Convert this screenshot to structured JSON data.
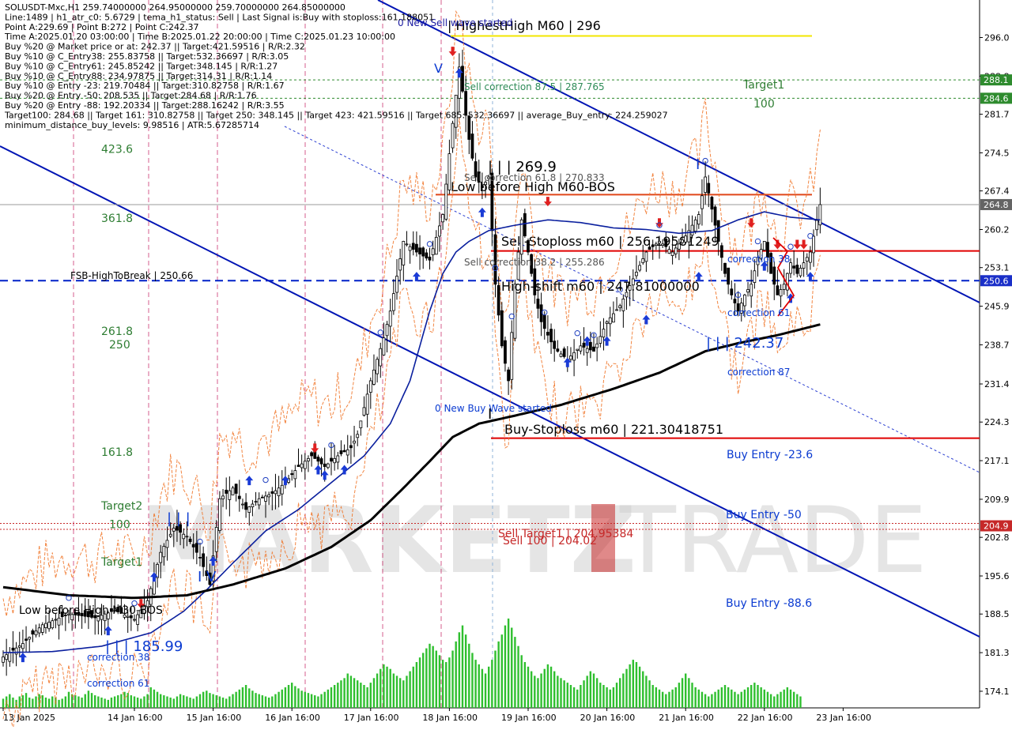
{
  "header": {
    "lines": [
      "SOLUSDT-Mxc,H1  259.74000000 264.95000000 259.70000000 264.85000000",
      "Line:1489 | h1_atr_c0: 5.6729 | tema_h1_status: Sell | Last Signal is:Buy with stoploss:161.188051",
      "Point A:229.69 | Point B:272 | Point C:242.37",
      "Time A:2025.01.20 03:00:00 | Time B:2025.01.22 20:00:00 | Time C:2025.01.23 10:00:00",
      "Buy %20 @ Market price or at: 242.37 || Target:421.59516 | R/R:2.32",
      "Buy %10 @ C_Entry38: 255.83758 || Target:532.36697 | R/R:3.05",
      "Buy %10 @ C_Entry61: 245.85242 || Target:348.145 | R/R:1.27",
      "Buy %10 @ C_Entry88: 234.97875 || Target:314.31 | R/R:1.14",
      "Buy %10 @ Entry -23: 219.70484 || Target:310.82758 | R/R:1.67",
      "Buy %20 @ Entry -50: 208.535 || Target:284.68 | R/R:1.76",
      "Buy %20 @ Entry -88: 192.20334 || Target:288.16242 | R/R:3.55",
      "Target100: 284.68 || Target 161: 310.82758 || Target 250: 348.145 || Target 423: 421.59516 || Target 685: 532.36697 || average_Buy_entry: 224.259027",
      "minimum_distance_buy_levels: 9.98516 | ATR:5.67285714"
    ]
  },
  "watermark": {
    "left": "MARKETZ",
    "right": "TRADE"
  },
  "chart_data": {
    "type": "line",
    "title": "SOLUSDT-Mxc,H1",
    "ylim": [
      171.0,
      303.0
    ],
    "y_ticks": [
      {
        "label": "296.0",
        "value": 296.0
      },
      {
        "label": "288.8",
        "value": 288.8
      },
      {
        "label": "281.7",
        "value": 281.7
      },
      {
        "label": "274.5",
        "value": 274.5
      },
      {
        "label": "267.4",
        "value": 267.4
      },
      {
        "label": "260.2",
        "value": 260.2
      },
      {
        "label": "253.1",
        "value": 253.1
      },
      {
        "label": "245.9",
        "value": 245.9
      },
      {
        "label": "238.7",
        "value": 238.7
      },
      {
        "label": "231.4",
        "value": 231.4
      },
      {
        "label": "224.3",
        "value": 224.3
      },
      {
        "label": "217.1",
        "value": 217.1
      },
      {
        "label": "209.9",
        "value": 209.9
      },
      {
        "label": "202.8",
        "value": 202.8
      },
      {
        "label": "195.6",
        "value": 195.6
      },
      {
        "label": "188.5",
        "value": 188.5
      },
      {
        "label": "181.3",
        "value": 181.3
      },
      {
        "label": "174.1",
        "value": 174.1
      }
    ],
    "x_ticks": [
      {
        "label": "13 Jan 2025",
        "idx": 0
      },
      {
        "label": "14 Jan 16:00",
        "idx": 40
      },
      {
        "label": "15 Jan 16:00",
        "idx": 64
      },
      {
        "label": "16 Jan 16:00",
        "idx": 88
      },
      {
        "label": "17 Jan 16:00",
        "idx": 112
      },
      {
        "label": "18 Jan 16:00",
        "idx": 136
      },
      {
        "label": "19 Jan 16:00",
        "idx": 160
      },
      {
        "label": "20 Jan 16:00",
        "idx": 184
      },
      {
        "label": "21 Jan 16:00",
        "idx": 208
      },
      {
        "label": "22 Jan 16:00",
        "idx": 232
      },
      {
        "label": "23 Jan 16:00",
        "idx": 256
      }
    ],
    "price_anchors": [
      [
        0,
        180.5
      ],
      [
        6,
        183
      ],
      [
        12,
        186.5
      ],
      [
        20,
        188.5
      ],
      [
        28,
        187.8
      ],
      [
        34,
        189.2
      ],
      [
        40,
        187.5
      ],
      [
        44,
        191
      ],
      [
        48,
        200
      ],
      [
        52,
        204.5
      ],
      [
        56,
        203
      ],
      [
        60,
        199
      ],
      [
        63,
        194
      ],
      [
        66,
        210
      ],
      [
        70,
        212
      ],
      [
        74,
        208
      ],
      [
        78,
        210
      ],
      [
        82,
        211
      ],
      [
        86,
        213
      ],
      [
        90,
        216
      ],
      [
        94,
        218
      ],
      [
        98,
        216
      ],
      [
        102,
        218
      ],
      [
        106,
        219.5
      ],
      [
        108,
        222
      ],
      [
        112,
        232
      ],
      [
        116,
        240
      ],
      [
        118,
        245
      ],
      [
        122,
        258
      ],
      [
        126,
        256
      ],
      [
        130,
        254.5
      ],
      [
        134,
        263
      ],
      [
        137,
        280
      ],
      [
        139,
        290.5
      ],
      [
        142,
        277
      ],
      [
        144,
        270
      ],
      [
        146,
        268
      ],
      [
        148,
        270
      ],
      [
        150,
        250
      ],
      [
        152,
        238.5
      ],
      [
        154,
        232
      ],
      [
        156,
        250
      ],
      [
        158,
        262
      ],
      [
        160,
        256
      ],
      [
        162,
        248
      ],
      [
        164,
        243
      ],
      [
        168,
        238
      ],
      [
        172,
        236
      ],
      [
        176,
        238.5
      ],
      [
        180,
        237.5
      ],
      [
        184,
        243
      ],
      [
        188,
        246
      ],
      [
        192,
        251
      ],
      [
        196,
        256
      ],
      [
        200,
        258
      ],
      [
        204,
        256
      ],
      [
        208,
        259
      ],
      [
        212,
        263
      ],
      [
        214,
        270
      ],
      [
        216,
        264
      ],
      [
        218,
        258
      ],
      [
        220,
        252
      ],
      [
        222,
        248
      ],
      [
        224,
        245
      ],
      [
        226,
        248
      ],
      [
        228,
        250
      ],
      [
        230,
        255
      ],
      [
        232,
        258
      ],
      [
        234,
        252
      ],
      [
        236,
        248
      ],
      [
        238,
        250
      ],
      [
        240,
        254
      ],
      [
        242,
        252
      ],
      [
        246,
        256
      ],
      [
        249,
        264.85
      ]
    ],
    "sma_blue": [
      [
        0,
        181.3
      ],
      [
        15,
        181.5
      ],
      [
        30,
        182.5
      ],
      [
        45,
        185
      ],
      [
        55,
        189
      ],
      [
        62,
        193
      ],
      [
        70,
        198
      ],
      [
        80,
        204
      ],
      [
        90,
        208
      ],
      [
        100,
        213
      ],
      [
        110,
        218
      ],
      [
        118,
        224
      ],
      [
        124,
        232
      ],
      [
        130,
        245
      ],
      [
        134,
        252
      ],
      [
        138,
        256
      ],
      [
        142,
        258
      ],
      [
        148,
        260
      ],
      [
        156,
        261
      ],
      [
        166,
        262
      ],
      [
        176,
        261.5
      ],
      [
        186,
        260.5
      ],
      [
        196,
        260.2
      ],
      [
        206,
        259.5
      ],
      [
        216,
        260
      ],
      [
        224,
        262
      ],
      [
        232,
        263.5
      ],
      [
        240,
        262.5
      ],
      [
        249,
        262
      ]
    ],
    "sma_black": [
      [
        0,
        193.5
      ],
      [
        20,
        192
      ],
      [
        40,
        191.5
      ],
      [
        56,
        192
      ],
      [
        70,
        194
      ],
      [
        86,
        197
      ],
      [
        100,
        201
      ],
      [
        112,
        206
      ],
      [
        122,
        212
      ],
      [
        130,
        217
      ],
      [
        137,
        221.5
      ],
      [
        145,
        224
      ],
      [
        156,
        225.5
      ],
      [
        170,
        227.5
      ],
      [
        186,
        230.5
      ],
      [
        200,
        233.5
      ],
      [
        214,
        237.5
      ],
      [
        224,
        239
      ],
      [
        236,
        240.5
      ],
      [
        249,
        242.5
      ]
    ],
    "volume": [
      8,
      10,
      12,
      9,
      7,
      10,
      11,
      13,
      9,
      8,
      10,
      12,
      11,
      9,
      8,
      10,
      9,
      7,
      8,
      10,
      14,
      12,
      11,
      10,
      9,
      12,
      15,
      13,
      11,
      10,
      9,
      8,
      7,
      9,
      10,
      11,
      12,
      14,
      13,
      11,
      10,
      9,
      8,
      10,
      12,
      18,
      16,
      14,
      12,
      11,
      10,
      9,
      8,
      10,
      12,
      11,
      10,
      9,
      8,
      10,
      12,
      14,
      15,
      13,
      12,
      11,
      10,
      9,
      8,
      10,
      12,
      14,
      16,
      18,
      20,
      17,
      15,
      13,
      12,
      11,
      10,
      9,
      10,
      12,
      14,
      16,
      18,
      20,
      22,
      19,
      17,
      15,
      14,
      13,
      12,
      11,
      10,
      12,
      14,
      16,
      18,
      20,
      22,
      24,
      26,
      30,
      28,
      26,
      24,
      22,
      20,
      18,
      22,
      26,
      30,
      34,
      38,
      36,
      34,
      30,
      28,
      26,
      24,
      28,
      32,
      36,
      40,
      44,
      48,
      52,
      56,
      54,
      50,
      46,
      42,
      40,
      44,
      50,
      58,
      66,
      72,
      64,
      56,
      48,
      42,
      38,
      34,
      30,
      36,
      42,
      50,
      58,
      64,
      72,
      78,
      70,
      62,
      54,
      46,
      40,
      36,
      32,
      28,
      26,
      30,
      34,
      38,
      36,
      32,
      28,
      26,
      24,
      22,
      20,
      18,
      16,
      20,
      24,
      28,
      32,
      30,
      26,
      22,
      20,
      18,
      16,
      18,
      22,
      26,
      30,
      34,
      38,
      42,
      40,
      36,
      32,
      28,
      24,
      20,
      18,
      16,
      14,
      12,
      14,
      16,
      18,
      22,
      26,
      30,
      26,
      22,
      18,
      16,
      14,
      12,
      10,
      12,
      14,
      16,
      18,
      20,
      18,
      16,
      14,
      12,
      14,
      16,
      18,
      20,
      22,
      20,
      18,
      16,
      14,
      12,
      10,
      12,
      14,
      16,
      18,
      16,
      14,
      12,
      10
    ],
    "fib_left_labels": [
      {
        "label": "423.6",
        "y": 274.5
      },
      {
        "label": "361.8",
        "y": 261.6
      },
      {
        "label": "261.8",
        "y": 240.5
      },
      {
        "label": "250",
        "y": 238.0
      },
      {
        "label": "161.8",
        "y": 218.0
      },
      {
        "label": "Target2",
        "y": 208.0
      },
      {
        "label": "100",
        "y": 204.5
      },
      {
        "label": "Target1",
        "y": 197.5
      }
    ],
    "levels": [
      {
        "name": "highest-high",
        "label": "| HighestHigh   M60 | 296",
        "value": 296.3,
        "color": "#f2e600"
      },
      {
        "name": "low-before-high",
        "label": "Low before High   M60-BOS",
        "value": 266.7,
        "color": "#e0471a"
      },
      {
        "name": "sell-stoploss",
        "label": "Sell-Stoploss m60 | 256.19581249",
        "value": 256.2,
        "color": "#e00000"
      },
      {
        "name": "fsb-high-to-break",
        "label": "FSB-HighToBreak | 250.66",
        "value": 250.66,
        "color": "#0020c8"
      },
      {
        "name": "buy-stoploss",
        "label": "Buy-Stoploss m60 | 221.30418751",
        "value": 221.3,
        "color": "#e00000"
      }
    ],
    "annotations": [
      {
        "text": "0 New Sell wave started",
        "x": 503,
        "y": 33,
        "color": "#1a1aa0",
        "size": 12
      },
      {
        "text": "Sell correction 87.5 | 287.765",
        "x": 587,
        "y": 114,
        "color": "#2e8b57",
        "size": 12
      },
      {
        "text": "Target1",
        "x": 940,
        "y": 112,
        "color": "#2e7d32",
        "size": 14
      },
      {
        "text": "100",
        "x": 953,
        "y": 136,
        "color": "#2e7d32",
        "size": 14
      },
      {
        "text": "| | | 269.9",
        "x": 617,
        "y": 217,
        "color": "#000000",
        "size": 18
      },
      {
        "text": "Sell correction 61.8 | 270.833",
        "x": 587,
        "y": 229,
        "color": "#555555",
        "size": 12
      },
      {
        "text": "Sell correction 38.2 | 255.286",
        "x": 587,
        "y": 336,
        "color": "#555555",
        "size": 12
      },
      {
        "text": "High-shift m60 | 247.81000000",
        "x": 634,
        "y": 368,
        "color": "#000000",
        "size": 16
      },
      {
        "text": "correction 38",
        "x": 920,
        "y": 332,
        "color": "#0b3bd1",
        "size": 12
      },
      {
        "text": "correction 61",
        "x": 920,
        "y": 400,
        "color": "#0b3bd1",
        "size": 12
      },
      {
        "text": "| | | 242.37",
        "x": 893,
        "y": 440,
        "color": "#0b3bd1",
        "size": 18
      },
      {
        "text": "correction 87",
        "x": 920,
        "y": 475,
        "color": "#0b3bd1",
        "size": 12
      },
      {
        "text": "0 New Buy Wave started",
        "x": 550,
        "y": 521,
        "color": "#0b3bd1",
        "size": 12
      },
      {
        "text": "Buy Entry -23.6",
        "x": 919,
        "y": 580,
        "color": "#0b3bd1",
        "size": 14
      },
      {
        "text": "Buy Entry -50",
        "x": 918,
        "y": 656,
        "color": "#0b3bd1",
        "size": 14
      },
      {
        "text": "Sell Target1 | 204.95384",
        "x": 630,
        "y": 680,
        "color": "#c62828",
        "size": 14
      },
      {
        "text": "Sell 100 | 204.02",
        "x": 636,
        "y": 689,
        "color": "#c62828",
        "size": 14
      },
      {
        "text": "Buy Entry -88.6",
        "x": 918,
        "y": 768,
        "color": "#0b3bd1",
        "size": 14
      },
      {
        "text": "| | | 185.99",
        "x": 133,
        "y": 824,
        "color": "#0b3bd1",
        "size": 18
      },
      {
        "text": "correction 38",
        "x": 110,
        "y": 836,
        "color": "#0b3bd1",
        "size": 12
      },
      {
        "text": "correction 61",
        "x": 110,
        "y": 869,
        "color": "#0b3bd1",
        "size": 12
      },
      {
        "text": "Low before High   M30-BOS",
        "x": 24,
        "y": 777,
        "color": "#000000",
        "size": 14
      },
      {
        "text": "| | |",
        "x": 211,
        "y": 662,
        "color": "#0b3bd1",
        "size": 18
      },
      {
        "text": "I V",
        "x": 250,
        "y": 736,
        "color": "#0b3bd1",
        "size": 18
      },
      {
        "text": "V",
        "x": 549,
        "y": 92,
        "color": "#0b3bd1",
        "size": 16
      },
      {
        "text": "I",
        "x": 880,
        "y": 214,
        "color": "#0b3bd1",
        "size": 18
      },
      {
        "text": "I",
        "x": 617,
        "y": 530,
        "color": "#000000",
        "size": 18
      }
    ],
    "price_tags": [
      {
        "label": "288.1",
        "value": 288.1,
        "bg": "#2e8b2e"
      },
      {
        "label": "284.6",
        "value": 284.68,
        "bg": "#2e8b2e"
      },
      {
        "label": "264.8",
        "value": 264.85,
        "bg": "#646464"
      },
      {
        "label": "250.6",
        "value": 250.66,
        "bg": "#1a2fc8"
      },
      {
        "label": "204.9",
        "value": 204.95,
        "bg": "#c62828"
      }
    ]
  }
}
